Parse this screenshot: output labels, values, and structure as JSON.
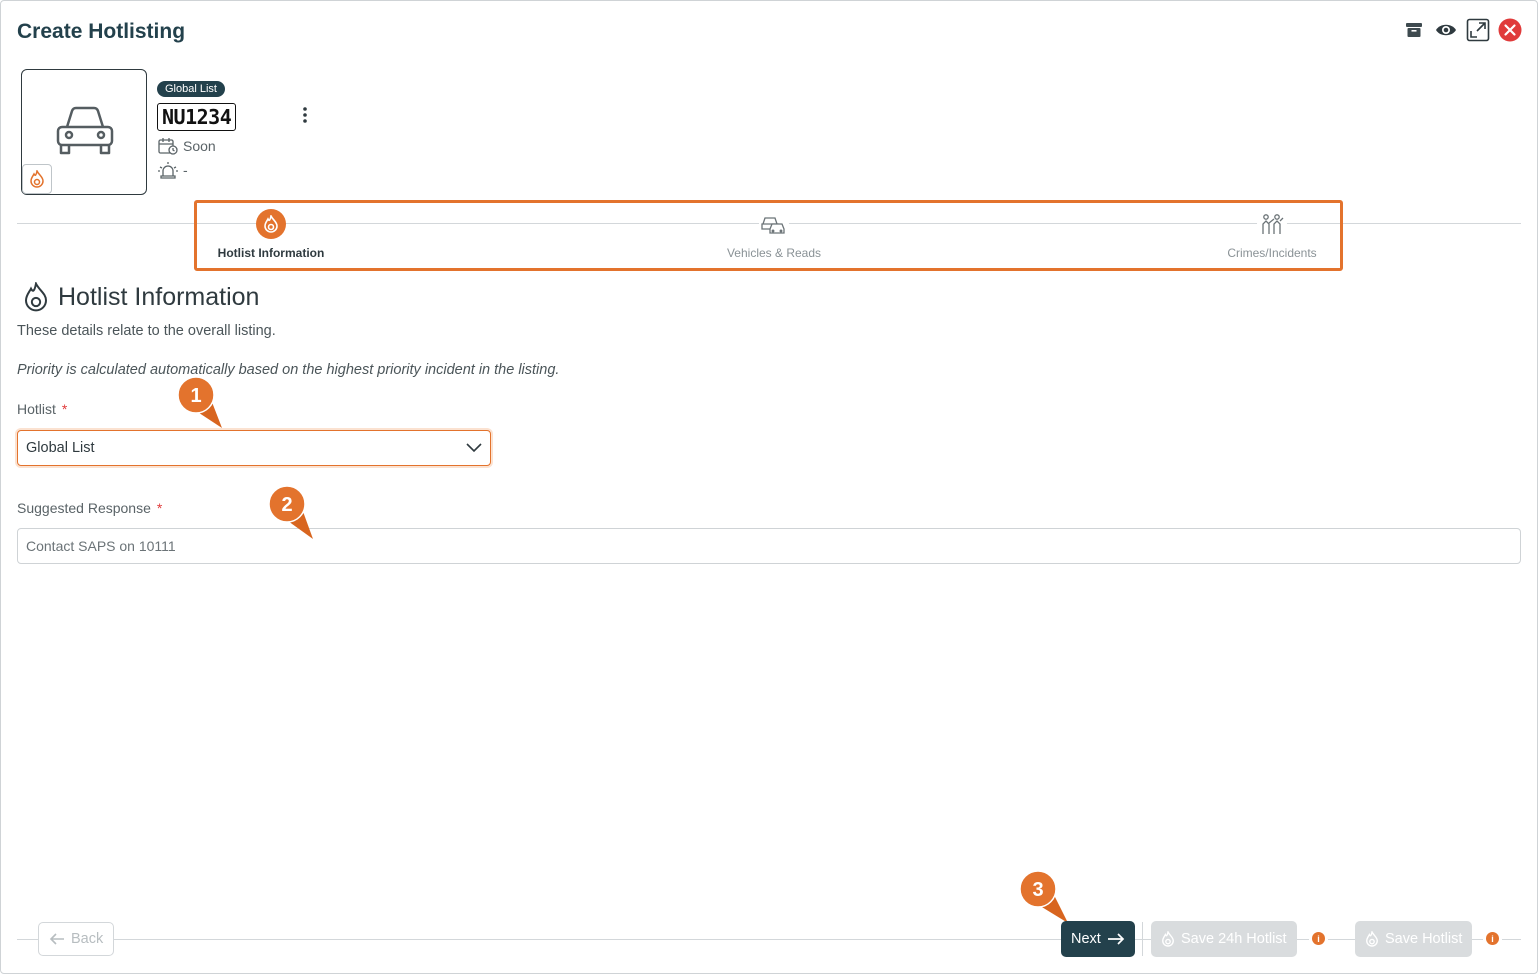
{
  "window": {
    "title": "Create Hotlisting"
  },
  "header_icons": [
    "archive-icon",
    "eye-icon",
    "expand-icon",
    "close-icon"
  ],
  "vehicle": {
    "list_badge": "Global List",
    "plate": "NU1234",
    "expiry": "Soon",
    "priority": "-"
  },
  "steps": [
    {
      "label": "Hotlist Information",
      "active": true
    },
    {
      "label": "Vehicles & Reads",
      "active": false
    },
    {
      "label": "Crimes/Incidents",
      "active": false
    }
  ],
  "section": {
    "title": "Hotlist Information",
    "description": "These details relate to the overall listing.",
    "note": "Priority is calculated automatically based on the highest priority incident in the listing."
  },
  "form": {
    "hotlist_label": "Hotlist",
    "hotlist_value": "Global List",
    "required_mark": "*",
    "response_label": "Suggested Response",
    "response_value": "Contact SAPS on 10111"
  },
  "callouts": [
    "1",
    "2",
    "3"
  ],
  "footer": {
    "back_label": "Back",
    "next_label": "Next",
    "save24_label": "Save 24h Hotlist",
    "save_label": "Save Hotlist",
    "info_mark": "i"
  },
  "colors": {
    "accent": "#e3732d",
    "primary": "#23414c",
    "danger": "#e03b3b",
    "disabled": "#d9dcde"
  }
}
